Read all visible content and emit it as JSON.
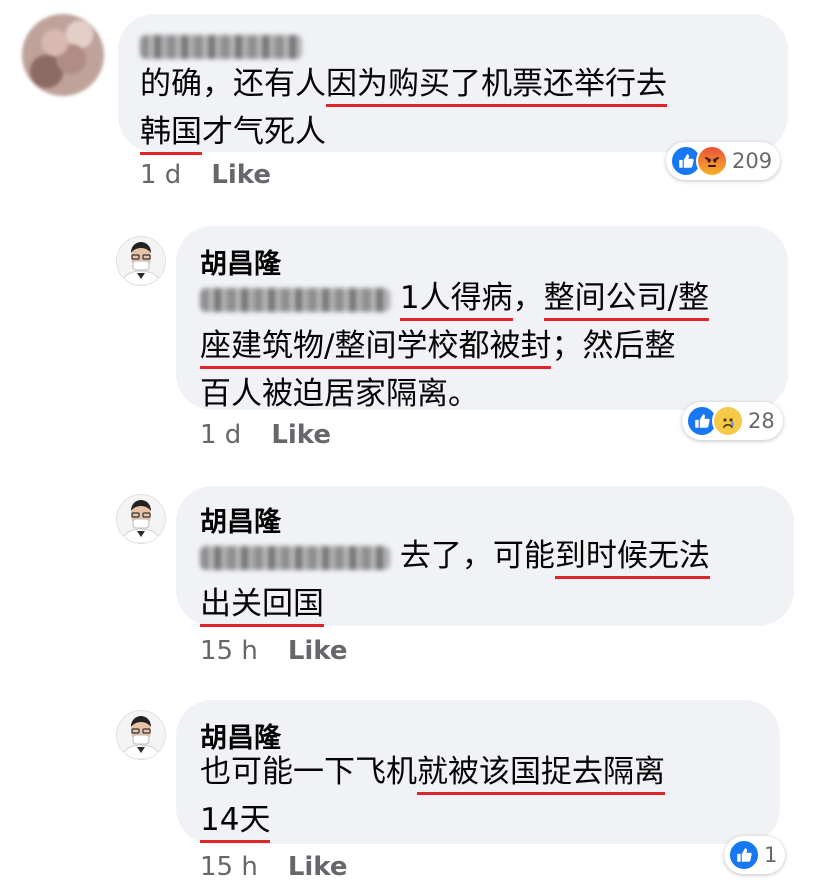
{
  "comments": [
    {
      "author": "",
      "text_lines": [
        [
          {
            "t": "的确，还有人"
          },
          {
            "t": "因为购买了机票还举行去",
            "u": true
          }
        ],
        [
          {
            "t": "韩国",
            "u": true
          },
          {
            "t": "才气死人"
          }
        ]
      ],
      "time": "1 d",
      "like_label": "Like",
      "reaction_count": "209",
      "reactions": [
        "like-icon",
        "angry-icon"
      ]
    },
    {
      "author": "胡昌隆",
      "text_lines": [
        [
          {
            "t": " "
          },
          {
            "t": "1人得病",
            "u": true
          },
          {
            "t": "，"
          },
          {
            "t": "整间公司/整",
            "u": true
          }
        ],
        [
          {
            "t": "座建筑物/整间学校都被封",
            "u": true
          },
          {
            "t": "；然后整"
          }
        ],
        [
          {
            "t": "百人被迫居家隔离。"
          }
        ]
      ],
      "time": "1 d",
      "like_label": "Like",
      "reaction_count": "28",
      "reactions": [
        "like-icon",
        "sad-icon"
      ]
    },
    {
      "author": "胡昌隆",
      "text_lines": [
        [
          {
            "t": " 去了，可能"
          },
          {
            "t": "到时候无法",
            "u": true
          }
        ],
        [
          {
            "t": "出关回国",
            "u": true
          }
        ]
      ],
      "time": "15 h",
      "like_label": "Like",
      "reaction_count": "",
      "reactions": []
    },
    {
      "author": "胡昌隆",
      "text_lines": [
        [
          {
            "t": "也可能一下飞机"
          },
          {
            "t": "就被该国捉去隔离",
            "u": true
          }
        ],
        [
          {
            "t": "14天",
            "u": true
          }
        ]
      ],
      "time": "15 h",
      "like_label": "Like",
      "reaction_count": "1",
      "reactions": [
        "like-icon"
      ]
    }
  ]
}
